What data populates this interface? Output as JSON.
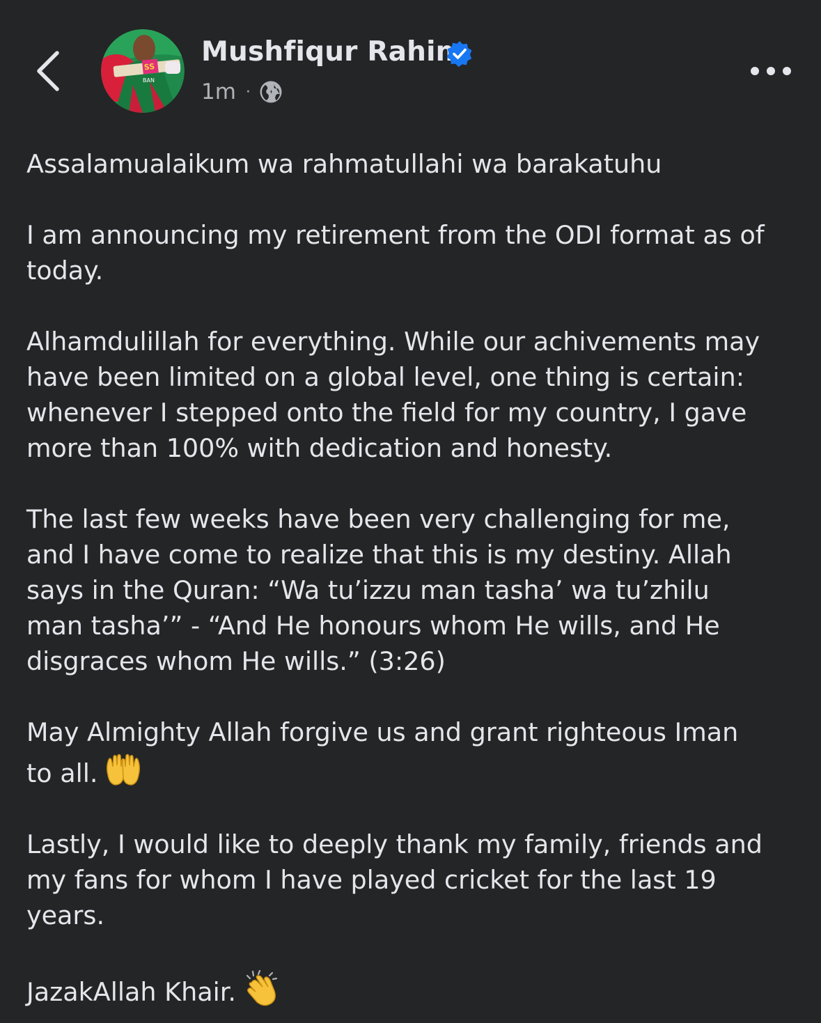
{
  "header": {
    "back_icon": "chevron-left-icon",
    "author_name": "Mushfiqur Rahim",
    "verified_icon": "verified-badge-icon",
    "timestamp": "1m",
    "separator": "·",
    "audience_icon": "globe-icon",
    "more_icon": "more-horizontal-icon",
    "avatar_text": "BAN"
  },
  "post": {
    "paragraphs": [
      "Assalamualaikum wa rahmatullahi wa barakatuhu",
      "I am announcing my retirement from the ODI format as of\ntoday.",
      "Alhamdulillah for everything. While our achivements may\nhave been limited on a global level, one thing is certain:\nwhenever I stepped onto the field for my country, I gave\nmore than 100% with dedication and honesty.",
      "The last few weeks have been very challenging for me,\nand I have come to realize that this is my destiny. Allah\nsays in the Quran: “Wa tu’izzu man tasha’ wa tu’zhilu\nman tasha’” - “And He honours whom He wills, and He\ndisgraces whom He wills.” (3:26)",
      "May Almighty Allah forgive us and grant righteous Iman\nto all.",
      "Lastly, I would like to deeply thank my family, friends and\nmy fans for whom I have played cricket for the last 19\nyears.",
      "JazakAllah Khair."
    ],
    "emojis": {
      "palms_up": "palms-up-together-emoji",
      "clapping": "clapping-hands-emoji"
    }
  },
  "colors": {
    "background": "#242526",
    "text_primary": "#e4e6eb",
    "text_secondary": "#b0b3b8",
    "verified_blue": "#1877f2"
  }
}
